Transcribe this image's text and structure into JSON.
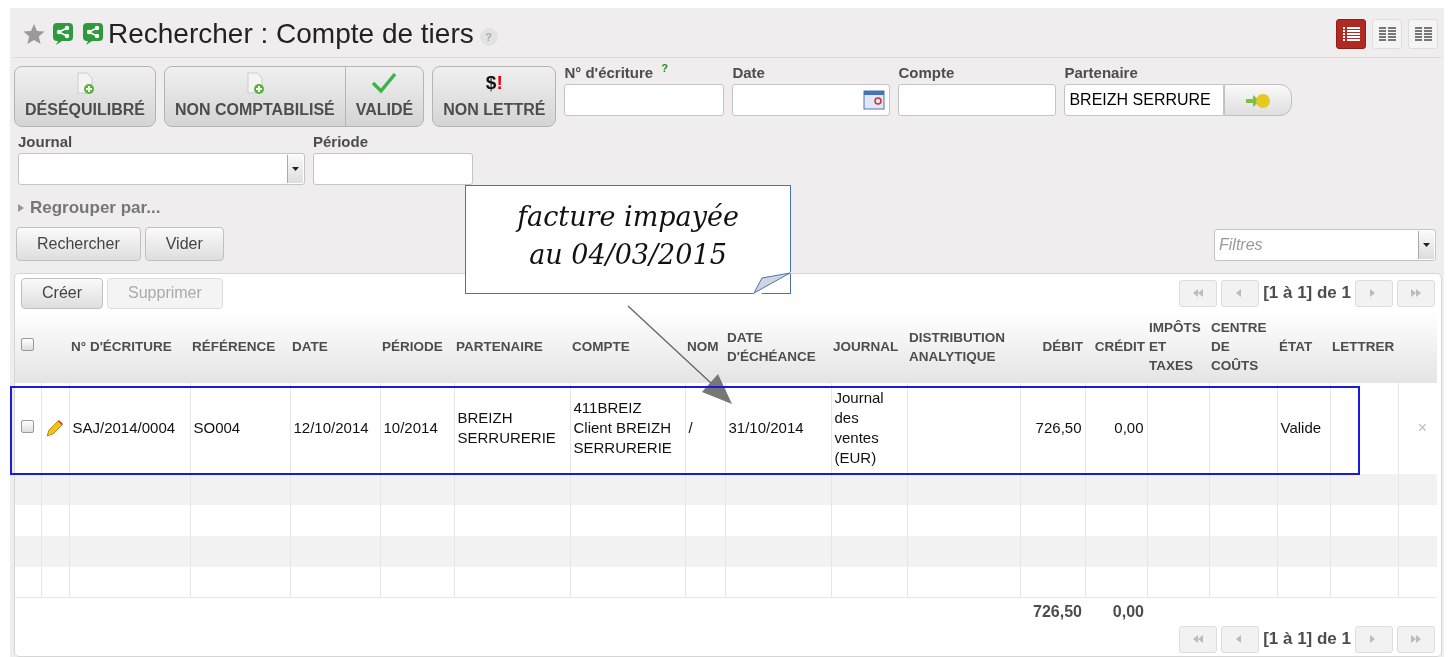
{
  "header": {
    "title": "Rechercher : Compte de tiers",
    "help_glyph": "?",
    "view_modes": [
      {
        "selected": true
      },
      {
        "selected": false
      },
      {
        "selected": false
      }
    ]
  },
  "filter_buttons": [
    {
      "groups": [
        [
          {
            "label": "DÉSÉQUILIBRÉ",
            "kind": "document",
            "selected": false
          }
        ]
      ]
    },
    {
      "groups": [
        [
          {
            "label": "NON COMPTABILISÉ",
            "kind": "document",
            "selected": false
          },
          {
            "label": "VALIDÉ",
            "kind": "check",
            "selected": false
          }
        ]
      ]
    },
    {
      "groups": [
        [
          {
            "label": "NON LETTRÉ",
            "kind": "currency",
            "glyph": "$",
            "glyph_mark": "!",
            "selected": false
          }
        ]
      ]
    }
  ],
  "fields": [
    {
      "label": "N° d'écriture",
      "kind": "text",
      "help_mark": "?"
    },
    {
      "label": "Date",
      "kind": "date"
    },
    {
      "label": "Compte",
      "kind": "text"
    },
    {
      "label": "Partenaire",
      "kind": "lookup",
      "value": "BREIZH SERRURE"
    }
  ],
  "fields_row2": [
    {
      "label": "Journal",
      "kind": "select"
    },
    {
      "label": "Période",
      "kind": "text"
    }
  ],
  "group_by": "Regrouper par...",
  "search_buttons": [
    "Rechercher",
    "Vider"
  ],
  "filters_select": {
    "placeholder": "Filtres"
  },
  "list": {
    "create": "Créer",
    "delete": {
      "label": "Supprimer",
      "disabled": true
    },
    "pager": "[1 à 1] de 1",
    "header_checkbox": {
      "checked": false
    },
    "columns": [
      {
        "label": "N° D'ÉCRITURE",
        "kind": "text"
      },
      {
        "label": "RÉFÉRENCE",
        "kind": "text"
      },
      {
        "label": "DATE",
        "kind": "text"
      },
      {
        "label": "PÉRIODE",
        "kind": "text"
      },
      {
        "label": "PARTENAIRE",
        "kind": "text"
      },
      {
        "label": "COMPTE",
        "kind": "text"
      },
      {
        "label": "NOM",
        "kind": "text"
      },
      {
        "label": "DATE D'ÉCHÉANCE",
        "kind": "text"
      },
      {
        "label": "JOURNAL",
        "kind": "text"
      },
      {
        "label": "DISTRIBUTION ANALYTIQUE",
        "kind": "text"
      },
      {
        "label": "DÉBIT",
        "kind": "amount",
        "total": "726,50"
      },
      {
        "label": "CRÉDIT",
        "kind": "amount",
        "total": "0,00"
      },
      {
        "label": "IMPÔTS ET TAXES",
        "kind": "text"
      },
      {
        "label": "CENTRE DE COÛTS",
        "kind": "text"
      },
      {
        "label": "ÉTAT",
        "kind": "text"
      },
      {
        "label": "LETTRER",
        "kind": "text"
      }
    ],
    "rows": [
      {
        "checked": false,
        "highlighted": true,
        "delete_glyph": "×",
        "cells": [
          {
            "kind": "text",
            "text": "SAJ/2014/0004"
          },
          {
            "kind": "text",
            "text": "SO004"
          },
          {
            "kind": "text",
            "text": "12/10/2014"
          },
          {
            "kind": "text",
            "text": "10/2014"
          },
          {
            "kind": "text",
            "text": "BREIZH SERRURERIE"
          },
          {
            "kind": "text",
            "text": "411BREIZ Client BREIZH SERRURERIE"
          },
          {
            "kind": "text",
            "text": "/"
          },
          {
            "kind": "text",
            "text": "31/10/2014"
          },
          {
            "kind": "text",
            "text": "Journal des ventes (EUR)"
          },
          {
            "kind": "empty"
          },
          {
            "kind": "text",
            "text": "726,50"
          },
          {
            "kind": "text",
            "text": "0,00"
          },
          {
            "kind": "empty"
          },
          {
            "kind": "empty"
          },
          {
            "kind": "text",
            "text": "Valide"
          },
          {
            "kind": "empty"
          }
        ]
      }
    ],
    "bottom_pager": "[1 à 1] de 1"
  },
  "callout": {
    "lines": [
      "facture impayée",
      "au 04/03/2015"
    ]
  }
}
